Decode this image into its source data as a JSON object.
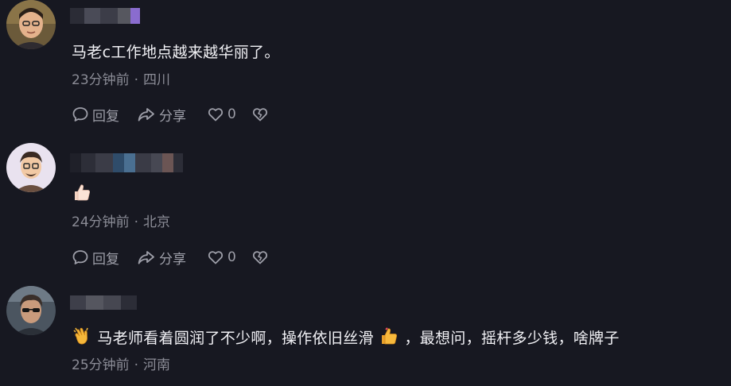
{
  "comments": [
    {
      "text": "马老c工作地点越来越华丽了。",
      "time": "23分钟前",
      "location": "四川",
      "reply_label": "回复",
      "share_label": "分享",
      "like_count": "0"
    },
    {
      "text": "",
      "emoji": "thumbs-up",
      "time": "24分钟前",
      "location": "北京",
      "reply_label": "回复",
      "share_label": "分享",
      "like_count": "0"
    },
    {
      "text_part1": "马老师看着圆润了不少啊，操作依旧丝滑",
      "text_part2": "，最想问，摇杆多少钱，啥牌子",
      "emojis": [
        "clapping-hands",
        "thumbs-up"
      ],
      "time": "25分钟前",
      "location": "河南"
    }
  ],
  "separator": "·",
  "colors": {
    "background": "#171821",
    "text": "#f1f1f5",
    "meta": "#8b8c96",
    "action": "#9d9ea8"
  },
  "icons": [
    "reply-bubble-icon",
    "share-arrow-icon",
    "heart-icon",
    "broken-heart-icon"
  ]
}
